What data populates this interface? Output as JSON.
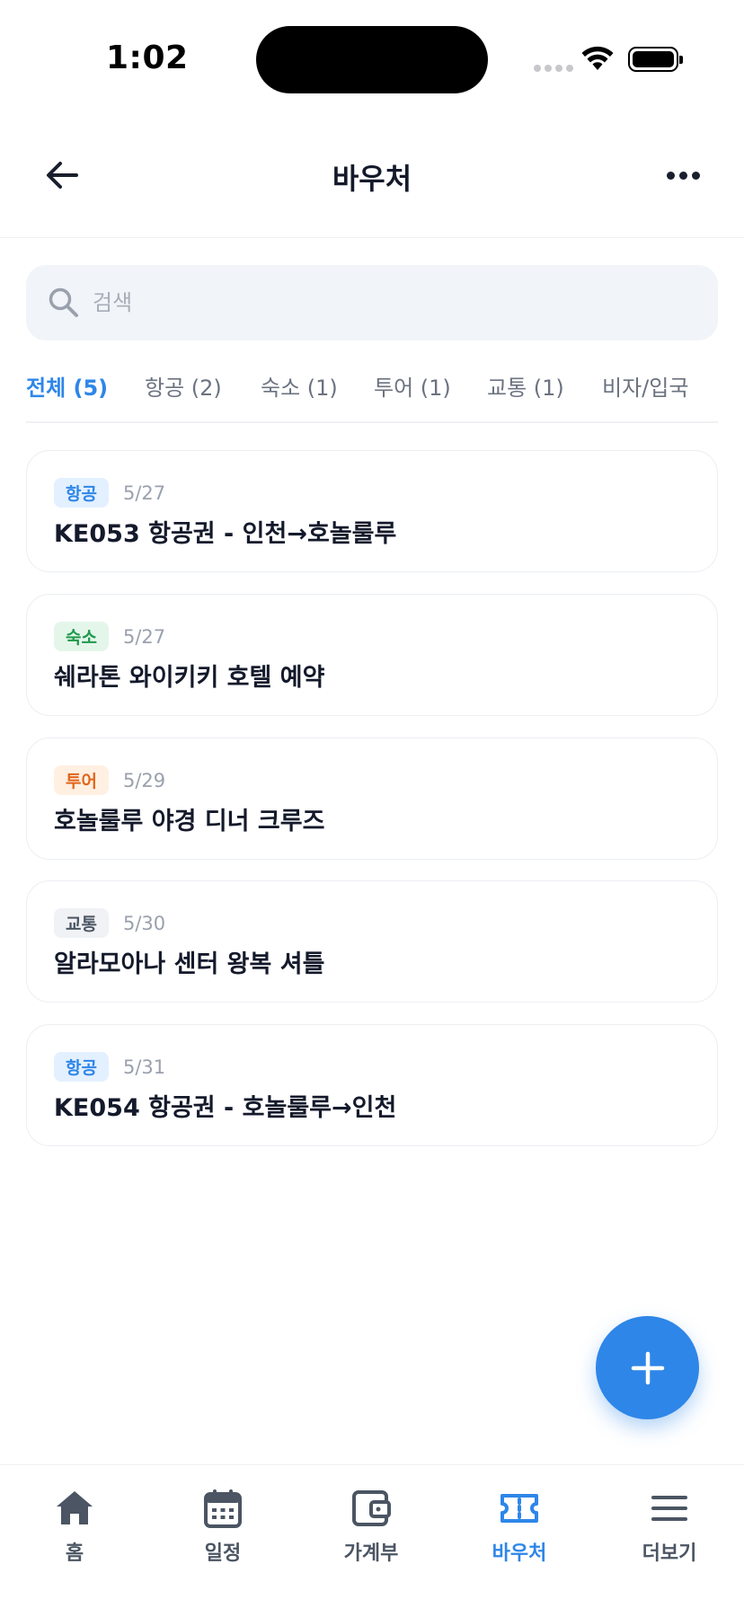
{
  "status_bar": {
    "time": "1:02"
  },
  "header": {
    "title": "바우처"
  },
  "search": {
    "placeholder": "검색"
  },
  "tabs": [
    {
      "label": "전체 (5)",
      "active": true
    },
    {
      "label": "항공 (2)",
      "active": false
    },
    {
      "label": "숙소 (1)",
      "active": false
    },
    {
      "label": "투어 (1)",
      "active": false
    },
    {
      "label": "교통 (1)",
      "active": false
    },
    {
      "label": "비자/입국",
      "active": false
    }
  ],
  "vouchers": [
    {
      "category": "항공",
      "date": "5/27",
      "title": "KE053 항공권 - 인천→호놀룰루"
    },
    {
      "category": "숙소",
      "date": "5/27",
      "title": "쉐라톤 와이키키 호텔 예약"
    },
    {
      "category": "투어",
      "date": "5/29",
      "title": "호놀룰루 야경 디너 크루즈"
    },
    {
      "category": "교통",
      "date": "5/30",
      "title": "알라모아나 센터 왕복 셔틀"
    },
    {
      "category": "항공",
      "date": "5/31",
      "title": "KE054 항공권 - 호놀룰루→인천"
    }
  ],
  "bottom_nav": [
    {
      "label": "홈",
      "icon": "home-icon",
      "active": false
    },
    {
      "label": "일정",
      "icon": "calendar-icon",
      "active": false
    },
    {
      "label": "가계부",
      "icon": "wallet-icon",
      "active": false
    },
    {
      "label": "바우처",
      "icon": "ticket-icon",
      "active": true
    },
    {
      "label": "더보기",
      "icon": "menu-icon",
      "active": false
    }
  ],
  "colors": {
    "accent": "#2e86e8",
    "air": "#2e86e8",
    "hotel": "#1f9a4c",
    "tour": "#e2651a",
    "transport": "#4b5563"
  }
}
